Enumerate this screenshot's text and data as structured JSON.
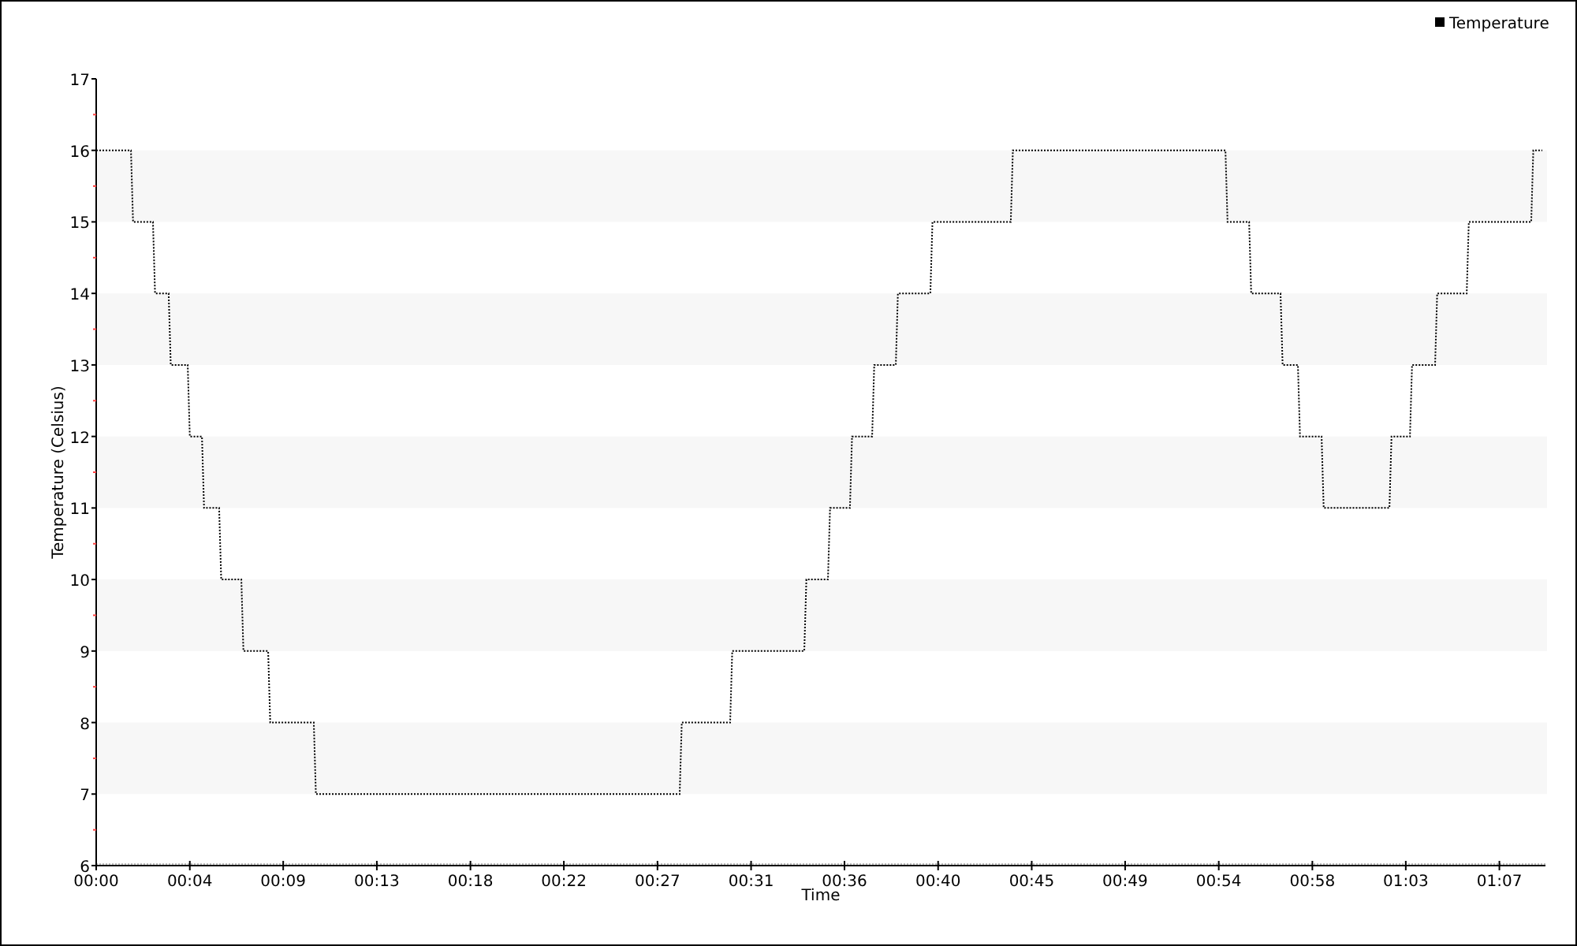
{
  "chart": {
    "chart_data": {
      "type": "line",
      "xlabel": "Time",
      "ylabel": "Temperature (Celsius)",
      "x": [
        0,
        1.66,
        1.76,
        2.71,
        2.81,
        3.46,
        3.56,
        4.37,
        4.47,
        5.05,
        5.15,
        5.87,
        5.97,
        6.93,
        7.03,
        8.21,
        8.31,
        10.39,
        10.49,
        27.86,
        27.96,
        30.27,
        30.37,
        33.81,
        33.91,
        34.94,
        35.04,
        35.99,
        36.09,
        37.05,
        37.15,
        38.18,
        38.28,
        39.83,
        39.93,
        43.67,
        43.77,
        53.92,
        54.02,
        55.05,
        55.15,
        56.55,
        56.65,
        57.38,
        57.48,
        58.51,
        58.61,
        61.75,
        61.85,
        62.73,
        62.83,
        63.93,
        64.03,
        65.44,
        65.54,
        68.52,
        68.62,
        69.05
      ],
      "series": [
        {
          "name": "Temperature",
          "color": "#000000",
          "line_style": "dotted",
          "values": [
            16,
            16,
            15,
            15,
            14,
            14,
            13,
            13,
            12,
            12,
            11,
            11,
            10,
            10,
            9,
            9,
            8,
            8,
            7,
            7,
            8,
            8,
            9,
            9,
            10,
            10,
            11,
            11,
            12,
            12,
            13,
            13,
            14,
            14,
            15,
            15,
            16,
            16,
            15,
            15,
            14,
            14,
            13,
            13,
            12,
            12,
            11,
            11,
            12,
            12,
            13,
            13,
            14,
            14,
            15,
            15,
            16,
            16
          ]
        }
      ],
      "xlim": [
        0,
        69.2
      ],
      "ylim": [
        6,
        17
      ],
      "xticks": [
        {
          "value": 0,
          "label": "00:00"
        },
        {
          "value": 4.47,
          "label": "00:04"
        },
        {
          "value": 8.93,
          "label": "00:09"
        },
        {
          "value": 13.4,
          "label": "00:13"
        },
        {
          "value": 17.87,
          "label": "00:18"
        },
        {
          "value": 22.33,
          "label": "00:22"
        },
        {
          "value": 26.8,
          "label": "00:27"
        },
        {
          "value": 31.27,
          "label": "00:31"
        },
        {
          "value": 35.73,
          "label": "00:36"
        },
        {
          "value": 40.2,
          "label": "00:40"
        },
        {
          "value": 44.67,
          "label": "00:45"
        },
        {
          "value": 49.13,
          "label": "00:49"
        },
        {
          "value": 53.6,
          "label": "00:54"
        },
        {
          "value": 58.07,
          "label": "00:58"
        },
        {
          "value": 62.53,
          "label": "01:03"
        },
        {
          "value": 67,
          "label": "01:07"
        }
      ],
      "yticks": [
        6,
        7,
        8,
        9,
        10,
        11,
        12,
        13,
        14,
        15,
        16,
        17
      ]
    }
  }
}
